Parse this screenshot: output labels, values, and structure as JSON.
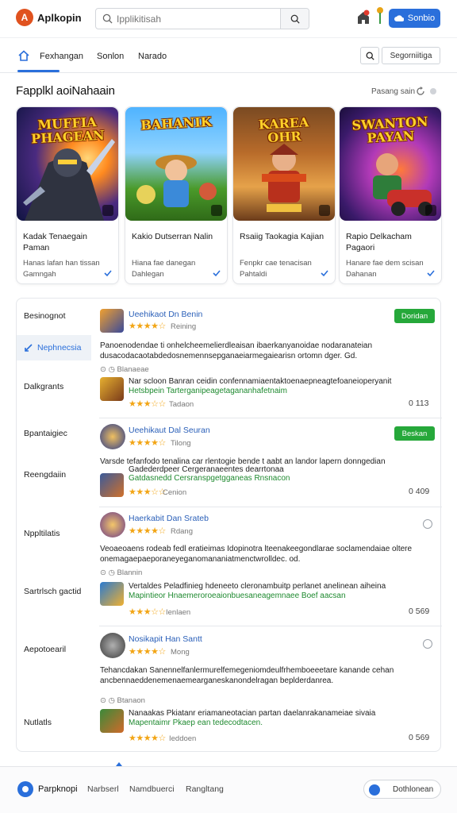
{
  "header": {
    "app_title": "Aplkopin",
    "search_placeholder": "Ipplikitisah",
    "button_label": "Sonbio"
  },
  "nav": {
    "tabs": [
      "Fexhangan",
      "Sonlon",
      "Narado"
    ],
    "segment_label": "Segorniitiga"
  },
  "section": {
    "title": "Fapplkl aoiNahaain",
    "link": "Pasang sain"
  },
  "cards": [
    {
      "art_title": "MUFFIA PHAGEAN",
      "name": "Kadak Tenaegain Paman",
      "desc": "Hanas lafan han tissan Gamngah"
    },
    {
      "art_title": "BAHANIK",
      "name": "Kakio Dutserran Nalin",
      "desc": "Hiana fae danegan Dahlegan"
    },
    {
      "art_title": "KAREA OHR",
      "name": "Rsaiig Taokagia Kajian",
      "desc": "Fenpkr cae tenacisan Pahtaldi"
    },
    {
      "art_title": "SWANTON PAYAN",
      "name": "Rapio Delkacham Pagaori",
      "desc": "Hanare fae dem scisan Dahanan"
    }
  ],
  "sidebar": {
    "items": [
      "Besinognot",
      "Nephnecsia",
      "Dalkgrants",
      "Bpantaigiec",
      "Reengdaiin",
      "Nppltilatis",
      "Sartrlsch gactid",
      "Aepotoearil",
      "Nutlatls"
    ],
    "active_index": 1
  },
  "entries": [
    {
      "title": "Ueehikaot Dn Benin",
      "stars": "★★★★☆",
      "rating": "Reining",
      "pill": "Doridan",
      "body": "Panoenodendae ti onhelcheemelierdleaisan ibaerkanyanoidae nodaranateian dusacodacaotabdedosnemennsepganaeiarmegaiearisn ortomn dger. Gd.",
      "meta": "Blanaeae",
      "sub_title": "Nar scloon Banran ceidin confennamiaentaktoenaepneagtefoaneioperyanit",
      "sub_green": "Hetsbpein Tarterganipeagetagananhafetnaim",
      "sub_stars": "★★★☆☆",
      "sub_rating": "Tadaon",
      "num": "0 113"
    },
    {
      "title": "Ueehikaut Dal Seuran",
      "stars": "★★★★☆",
      "rating": "Tilong",
      "pill": "Beskan",
      "body": "Varsde tefanfodo tenalina car rlentogie bende t aabt an landor lapern donngedian",
      "sub_title": "Gadederdpeer Cergeranaeentes dearrtonaa",
      "sub_green": "Gatdasnedd Cersranspgetgganeas Rnsnacon",
      "sub_stars": "★★★☆☆",
      "sub_rating": "Cenion",
      "num": "0 409"
    },
    {
      "title": "Haerkabit Dan Srateb",
      "stars": "★★★★☆",
      "rating": "Rdang",
      "body": "Veoaeoaens rodeab fedl eratieimas Idopinotra lteenakeegondlarae soclamendaiae oltere onemagaepaeporaneyeganomananiatmenctwrolldec. od.",
      "meta": "Blannin",
      "sub_title": "Vertaldes Peladfinieg hdeneeto cleronambuitp perlanet anelinean aiheina",
      "sub_green": "Mapintieor Hnaemeroroeaionbuesaneagemnaee Boef aacsan",
      "sub_stars": "★★★☆☆",
      "sub_rating": "Ienlaen",
      "num": "0 569"
    },
    {
      "title": "Nosikapit Han Santt",
      "stars": "★★★★☆",
      "rating": "Mong",
      "body": "Tehancdakan Sanennelfanlermurelfemegeniomdeulfrhemboeeetare kanande cehan ancbennaeddenemenaemearganeskanondelragan beplderdanrea.",
      "meta": "Btanaon",
      "sub_title": "Nanaakas Pkiatanr eriamaneotacian partan daelanrakanameiae sivaia",
      "sub_green": "Mapentaimr Pkaep ean tedecodtacen.",
      "sub_stars": "★★★★☆",
      "sub_rating": "Ieddoen",
      "num": "0 569"
    }
  ],
  "footer": {
    "title": "Parpknopi",
    "links": [
      "Narbserl",
      "Namdbuerci",
      "Rangltang"
    ],
    "button_label": "Dothlonean"
  },
  "colors": {
    "accent": "#2a6fdb",
    "green": "#26a83a",
    "star": "#f2a515"
  }
}
